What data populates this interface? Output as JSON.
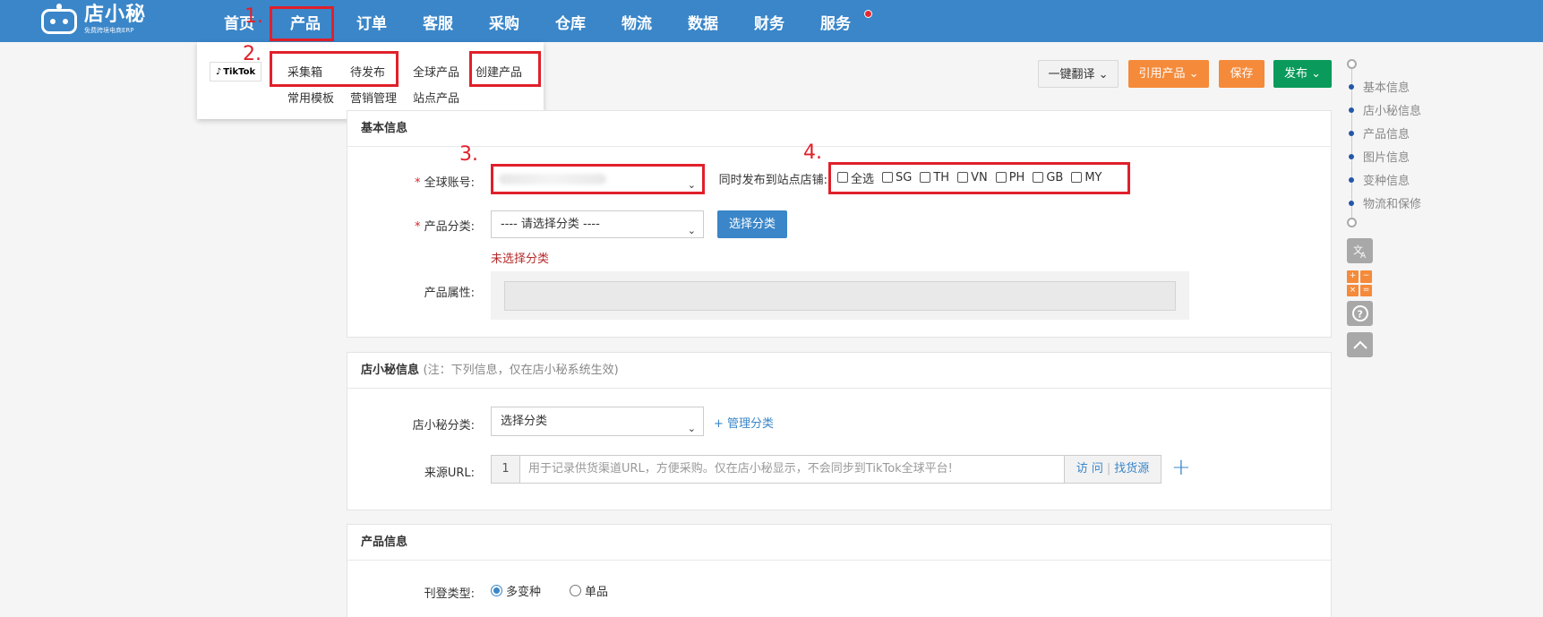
{
  "brand": {
    "name": "店小秘",
    "tagline": "免费跨境电商ERP"
  },
  "nav": {
    "items": [
      "首页",
      "产品",
      "订单",
      "客服",
      "采购",
      "仓库",
      "物流",
      "数据",
      "财务",
      "服务"
    ]
  },
  "annotations": {
    "a1": "1.",
    "a2": "2.",
    "a3": "3.",
    "a4": "4."
  },
  "dropdown": {
    "platform": "TikTok",
    "col1": [
      "采集箱",
      "常用模板"
    ],
    "col2": [
      "待发布",
      "营销管理"
    ],
    "col3": [
      "全球产品",
      "站点产品"
    ],
    "col4": [
      "创建产品"
    ]
  },
  "toolbar": {
    "translate": "一键翻译",
    "quote": "引用产品",
    "save": "保存",
    "publish": "发布"
  },
  "basic": {
    "title": "基本信息",
    "account_label": "全球账号:",
    "required_mark": "*",
    "sync_label": "同时发布到站点店铺:",
    "sites": [
      "全选",
      "SG",
      "TH",
      "VN",
      "PH",
      "GB",
      "MY"
    ],
    "category_label": "产品分类:",
    "category_placeholder": "---- 请选择分类 ----",
    "choose_category": "选择分类",
    "error": "未选择分类",
    "attr_label": "产品属性:"
  },
  "dxm": {
    "title": "店小秘信息",
    "note": "(注：下列信息，仅在店小秘系统生效)",
    "category_label": "店小秘分类:",
    "category_value": "选择分类",
    "manage_link": "+ 管理分类",
    "url_label": "来源URL:",
    "url_index": "1",
    "url_placeholder": "用于记录供货渠道URL，方便采购。仅在店小秘显示，不会同步到TikTok全球平台!",
    "visit": "访 问",
    "find_source": "找货源"
  },
  "product": {
    "title": "产品信息",
    "listing_label": "刊登类型:",
    "options": [
      "多变种",
      "单品"
    ],
    "selected": "多变种"
  },
  "right_nav": {
    "items": [
      "基本信息",
      "店小秘信息",
      "产品信息",
      "图片信息",
      "变种信息",
      "物流和保修"
    ]
  },
  "icons": {
    "translate_tool": "translate-icon",
    "calc_tool": "calculator-icon",
    "help_tool": "help-icon",
    "top_tool": "back-to-top-icon"
  },
  "colors": {
    "nav_bg": "#3a86c9",
    "annotation": "#e0202a",
    "orange": "#f58a3a",
    "green": "#0a9a5b"
  }
}
